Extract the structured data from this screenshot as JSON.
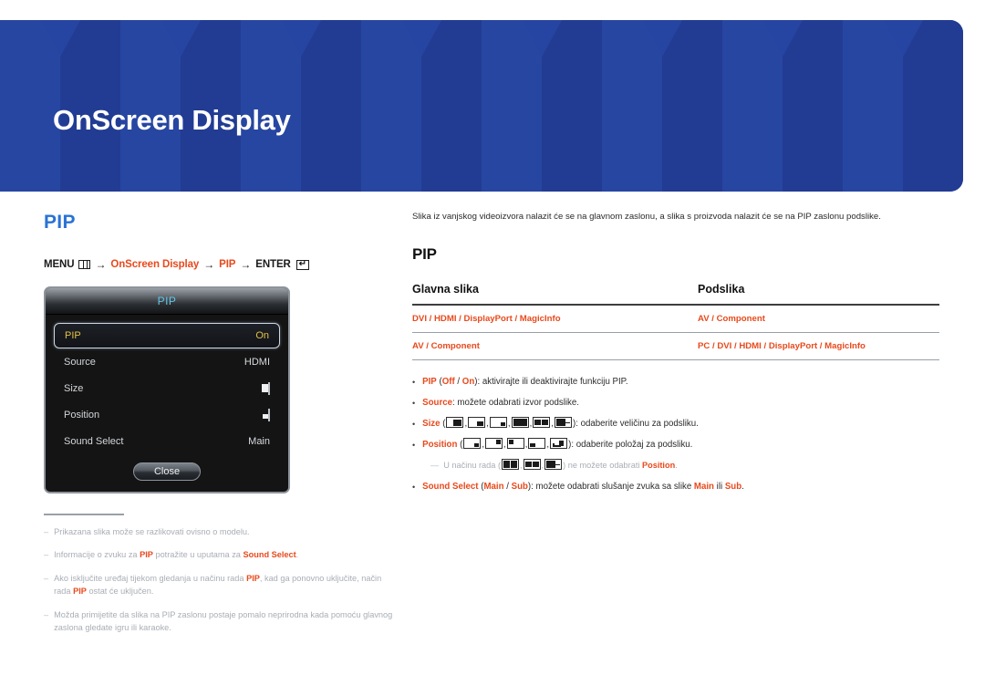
{
  "banner": {
    "title": "OnScreen Display",
    "bg_color": "#24409a"
  },
  "left": {
    "section_title": "PIP",
    "accent_color": "#2a72d4",
    "orange_color": "#e8491c",
    "menu_path": {
      "menu_label": "MENU",
      "menu_icon": "menu-bars-icon",
      "arrow": "→",
      "step1": "OnScreen Display",
      "step2": "PIP",
      "enter_label": "ENTER",
      "enter_icon": "enter-key-icon",
      "enter_glyph": "↵"
    },
    "osd": {
      "title": "PIP",
      "close_label": "Close",
      "rows": [
        {
          "label": "PIP",
          "value": "On",
          "selected": true,
          "value_type": "text"
        },
        {
          "label": "Source",
          "value": "HDMI",
          "selected": false,
          "value_type": "text"
        },
        {
          "label": "Size",
          "value": "",
          "selected": false,
          "value_type": "size-icon"
        },
        {
          "label": "Position",
          "value": "",
          "selected": false,
          "value_type": "position-icon"
        },
        {
          "label": "Sound Select",
          "value": "Main",
          "selected": false,
          "value_type": "text"
        }
      ]
    },
    "notes": [
      {
        "dash": "–",
        "parts": [
          {
            "t": "Prikazana slika može se razlikovati ovisno o modelu."
          }
        ]
      },
      {
        "dash": "–",
        "parts": [
          {
            "t": "Informacije o zvuku za "
          },
          {
            "t": "PIP",
            "b": true
          },
          {
            "t": " potražite u uputama za "
          },
          {
            "t": "Sound Select",
            "b": true
          },
          {
            "t": "."
          }
        ]
      },
      {
        "dash": "–",
        "parts": [
          {
            "t": "Ako isključite uređaj tijekom gledanja u načinu rada "
          },
          {
            "t": "PIP",
            "b": true
          },
          {
            "t": ", kad ga ponovno uključite, način rada "
          },
          {
            "t": "PIP",
            "b": true
          },
          {
            "t": " ostat će uključen."
          }
        ]
      },
      {
        "dash": "–",
        "parts": [
          {
            "t": "Možda primijetite da slika na PIP zaslonu postaje pomalo neprirodna kada pomoću glavnog zaslona gledate igru ili karaoke."
          }
        ]
      }
    ]
  },
  "right": {
    "intro": "Slika iz vanjskog videoizvora nalazit će se na glavnom zaslonu, a slika s proizvoda nalazit će se na PIP zaslonu podslike.",
    "title": "PIP",
    "table": {
      "headers": [
        "Glavna slika",
        "Podslika"
      ],
      "rows": [
        {
          "main": "DVI / HDMI / DisplayPort / MagicInfo",
          "sub": "AV / Component"
        },
        {
          "main": "AV / Component",
          "sub": "PC / DVI / HDMI / DisplayPort / MagicInfo"
        }
      ]
    },
    "bullets": [
      {
        "parts": [
          {
            "t": "PIP",
            "b": true
          },
          {
            "t": " ("
          },
          {
            "t": "Off",
            "b": true
          },
          {
            "t": " / "
          },
          {
            "t": "On",
            "b": true
          },
          {
            "t": "): aktivirajte ili deaktivirajte funkciju PIP."
          }
        ]
      },
      {
        "parts": [
          {
            "t": "Source",
            "b": true
          },
          {
            "t": ": možete odabrati izvor podslike."
          }
        ]
      },
      {
        "parts": [
          {
            "t": "Size",
            "b": true
          },
          {
            "t": " (",
            "icons": "size"
          },
          {
            "t": "): odaberite veličinu za podsliku."
          }
        ]
      },
      {
        "parts": [
          {
            "t": "Position",
            "b": true
          },
          {
            "t": " (",
            "icons": "position"
          },
          {
            "t": "): odaberite položaj za podsliku."
          }
        ]
      },
      {
        "parts": [
          {
            "t": "Sound Select",
            "b": true
          },
          {
            "t": " ("
          },
          {
            "t": "Main",
            "b": true
          },
          {
            "t": " / "
          },
          {
            "t": "Sub",
            "b": true
          },
          {
            "t": "): možete odabrati slušanje zvuka sa slike "
          },
          {
            "t": "Main",
            "b": true
          },
          {
            "t": " ili "
          },
          {
            "t": "Sub",
            "b": true
          },
          {
            "t": "."
          }
        ]
      }
    ],
    "subnote": {
      "dash": "—",
      "pre": "U načinu rada (",
      "post": ") ne možete odabrati ",
      "bold": "Position",
      "end": "."
    },
    "size_icons": [
      "size-large-icon",
      "size-medium-icon",
      "size-small-icon",
      "size-split-wide-icon",
      "size-split-even-icon",
      "size-split-dash-icon"
    ],
    "position_icons": [
      "position-bottom-right-icon",
      "position-top-right-icon",
      "position-top-left-icon",
      "position-bottom-left-icon",
      "position-custom-icon"
    ],
    "subnote_icons": [
      "size-split-wide-icon",
      "size-split-even-icon",
      "size-split-dash-icon"
    ]
  }
}
